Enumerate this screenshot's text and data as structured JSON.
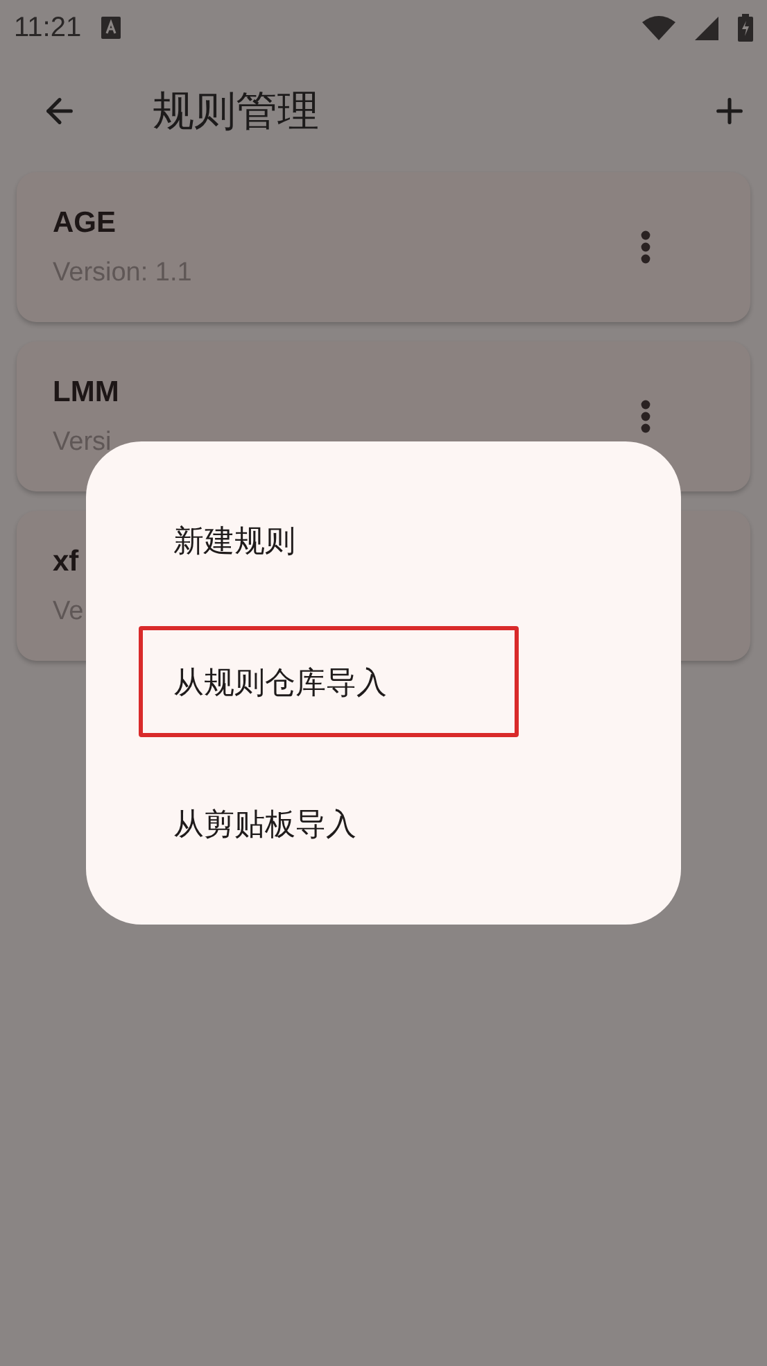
{
  "status_bar": {
    "time": "11:21"
  },
  "app_bar": {
    "title": "规则管理"
  },
  "rules": [
    {
      "name": "AGE",
      "version": "Version: 1.1",
      "options_button": true
    },
    {
      "name": "LMM",
      "version": "Versi",
      "options_button": true
    },
    {
      "name": "xf",
      "version": "Ve"
    }
  ],
  "dialog": {
    "items": [
      {
        "label": "新建规则",
        "highlighted": false
      },
      {
        "label": "从规则仓库导入",
        "highlighted": true
      },
      {
        "label": "从剪贴板导入",
        "highlighted": false
      }
    ]
  }
}
